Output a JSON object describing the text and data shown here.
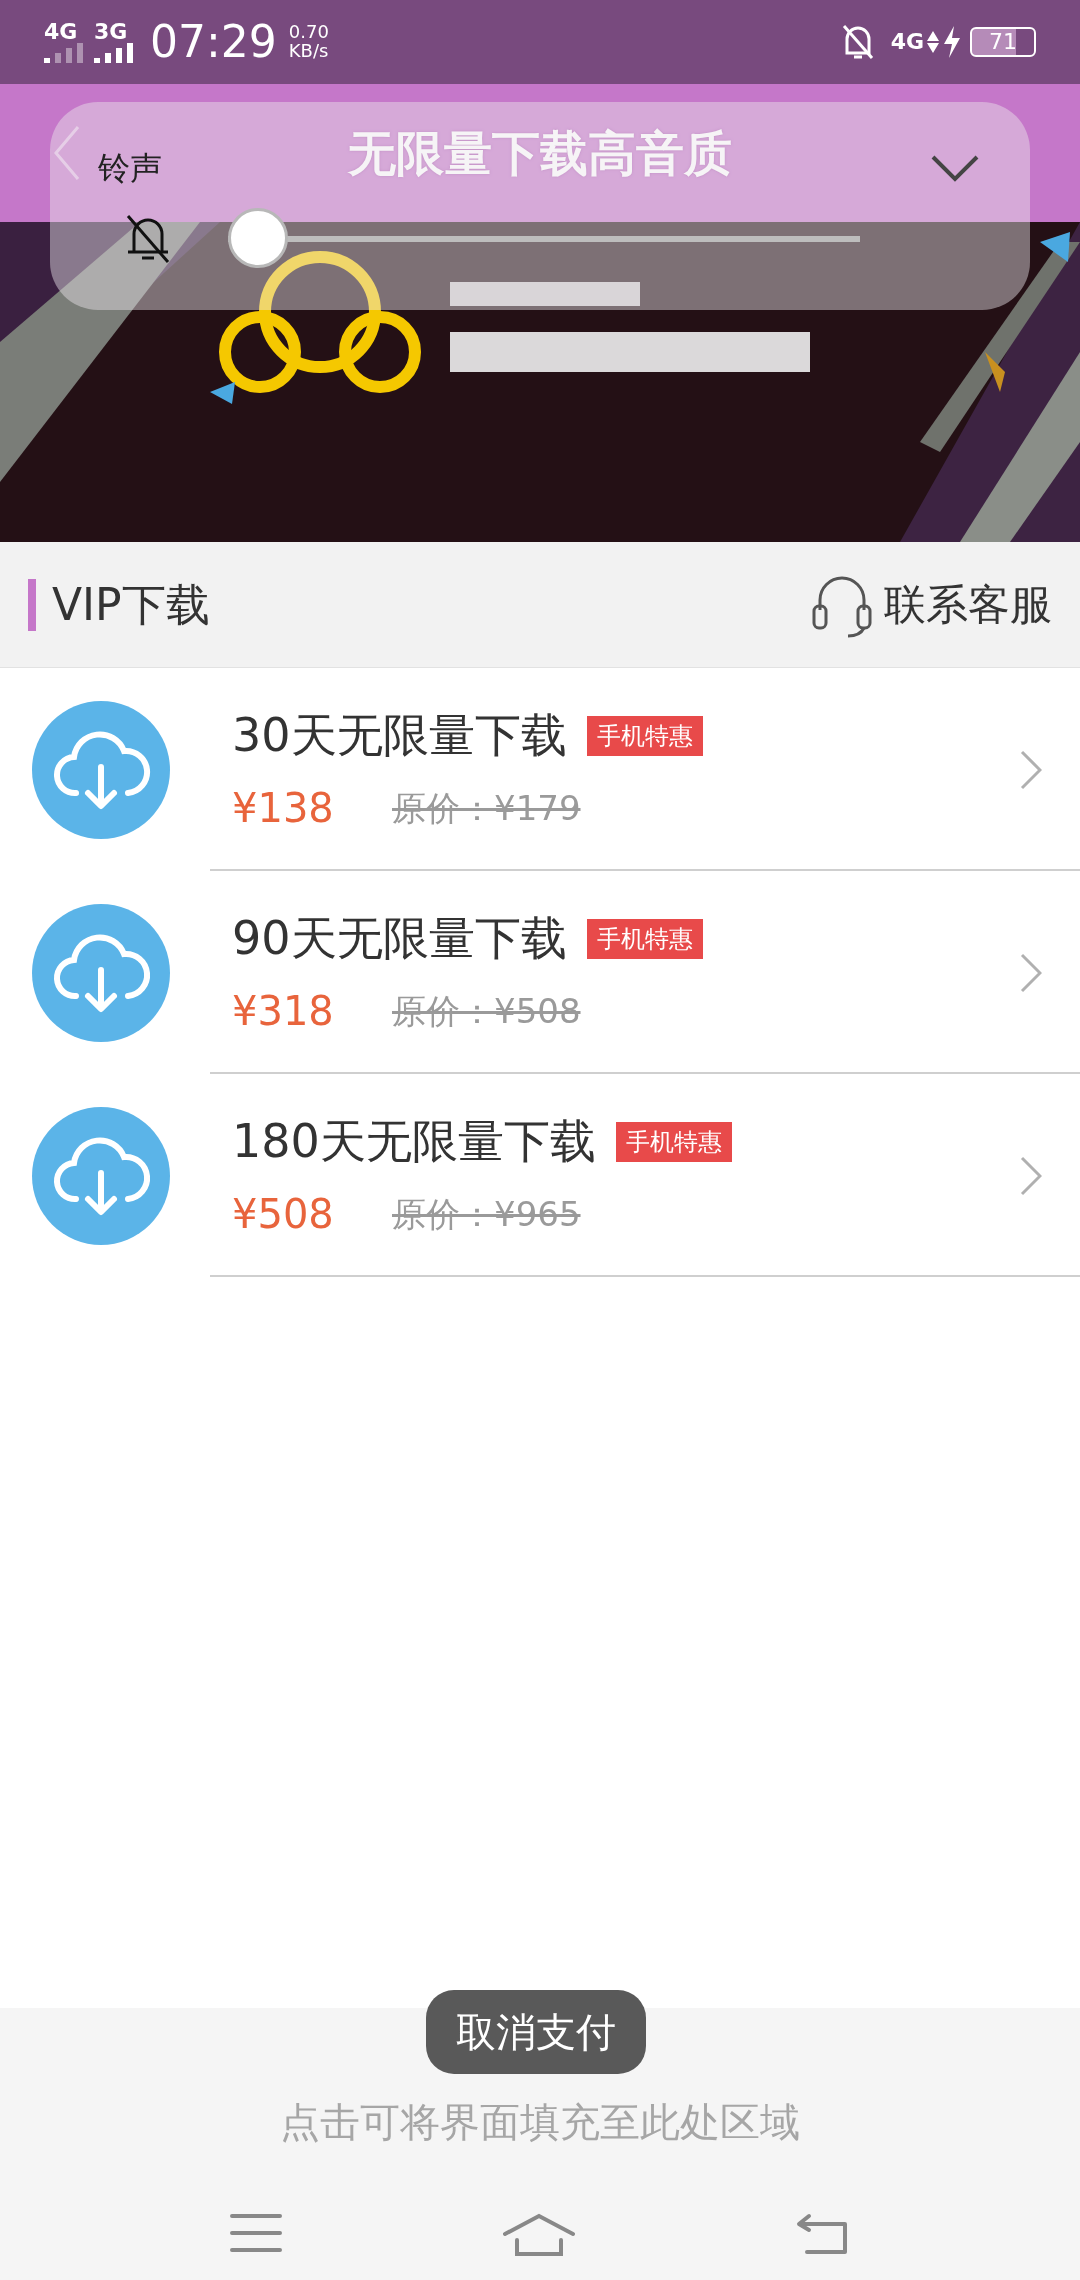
{
  "status_bar": {
    "network_1": "4G",
    "network_2": "3G",
    "time": "07:29",
    "speed": "0.70",
    "speed_unit": "KB/s",
    "network_3": "4G",
    "battery": "71"
  },
  "header": {
    "title": "无限量下载高音质"
  },
  "volume_panel": {
    "label": "铃声",
    "muted": true,
    "level": 0
  },
  "section": {
    "title": "VIP下载",
    "support": "联系客服"
  },
  "plans": [
    {
      "title": "30天无限量下载",
      "tag": "手机特惠",
      "price": "¥138",
      "original_price": "原价：¥179"
    },
    {
      "title": "90天无限量下载",
      "tag": "手机特惠",
      "price": "¥318",
      "original_price": "原价：¥508"
    },
    {
      "title": "180天无限量下载",
      "tag": "手机特惠",
      "price": "¥508",
      "original_price": "原价：¥965"
    }
  ],
  "toast": "取消支付",
  "footer": {
    "hint": "点击可将界面填充至此处区域"
  }
}
